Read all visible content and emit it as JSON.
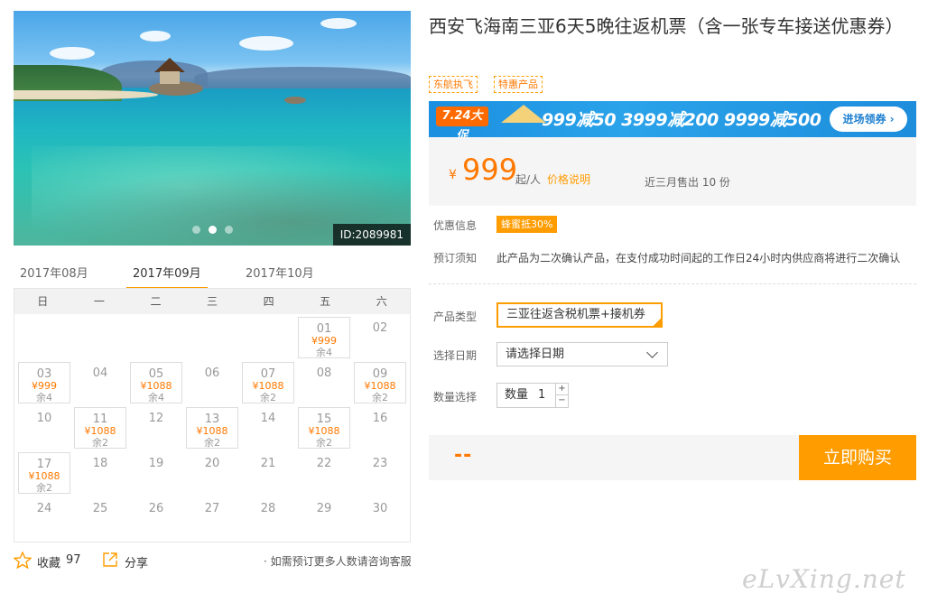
{
  "hero": {
    "image_id": "ID:2089981",
    "slide_count": 3,
    "active_slide": 2
  },
  "calendar": {
    "months": [
      "2017年08月",
      "2017年09月",
      "2017年10月"
    ],
    "active_month": "2017年09月",
    "weekdays": [
      "日",
      "一",
      "二",
      "三",
      "四",
      "五",
      "六"
    ],
    "days": [
      {
        "day": "01",
        "price": "¥999",
        "remain": "余4"
      },
      {
        "day": "02"
      },
      {
        "day": "03",
        "price": "¥999",
        "remain": "余4"
      },
      {
        "day": "04"
      },
      {
        "day": "05",
        "price": "¥1088",
        "remain": "余4"
      },
      {
        "day": "06"
      },
      {
        "day": "07",
        "price": "¥1088",
        "remain": "余2"
      },
      {
        "day": "08"
      },
      {
        "day": "09",
        "price": "¥1088",
        "remain": "余2"
      },
      {
        "day": "10"
      },
      {
        "day": "11",
        "price": "¥1088",
        "remain": "余2"
      },
      {
        "day": "12"
      },
      {
        "day": "13",
        "price": "¥1088",
        "remain": "余2"
      },
      {
        "day": "14"
      },
      {
        "day": "15",
        "price": "¥1088",
        "remain": "余2"
      },
      {
        "day": "16"
      },
      {
        "day": "17",
        "price": "¥1088",
        "remain": "余2"
      },
      {
        "day": "18"
      },
      {
        "day": "19"
      },
      {
        "day": "20"
      },
      {
        "day": "21"
      },
      {
        "day": "22"
      },
      {
        "day": "23"
      },
      {
        "day": "24"
      },
      {
        "day": "25"
      },
      {
        "day": "26"
      },
      {
        "day": "27"
      },
      {
        "day": "28"
      },
      {
        "day": "29"
      },
      {
        "day": "30"
      }
    ]
  },
  "footer": {
    "favorite_label": "收藏",
    "favorite_count": "97",
    "share_label": "分享",
    "consult_note": "· 如需预订更多人数请咨询客服"
  },
  "product": {
    "title": "西安飞海南三亚6天5晚往返机票（含一张专车接送优惠券）",
    "tags": [
      "东航执飞",
      "特惠产品"
    ]
  },
  "promo": {
    "badge": "7.24大促",
    "text": "999减50  3999减200  9999减500",
    "button": "进场领券 ›"
  },
  "price": {
    "symbol": "¥",
    "amount": "999",
    "per": "起/人",
    "explain": "价格说明",
    "sold": "近三月售出 10 份"
  },
  "info": {
    "discount_label": "优惠信息",
    "discount_badge": "蜂蜜抵30%",
    "notice_label": "预订须知",
    "notice_text": "此产品为二次确认产品，在支付成功时间起的工作日24小时内供应商将进行二次确认"
  },
  "form": {
    "type_label": "产品类型",
    "type_value": "三亚往返含税机票+接机券",
    "date_label": "选择日期",
    "date_placeholder": "请选择日期",
    "qty_label": "数量选择",
    "qty_prefix": "数量",
    "qty_value": "1",
    "plus": "+",
    "minus": "−"
  },
  "buy": {
    "total": "--",
    "button": "立即购买"
  },
  "watermark": "eLvXing.net",
  "colors": {
    "accent": "#ff9c00",
    "price": "#ff7800",
    "promo_blue": "#1b8fe0"
  }
}
